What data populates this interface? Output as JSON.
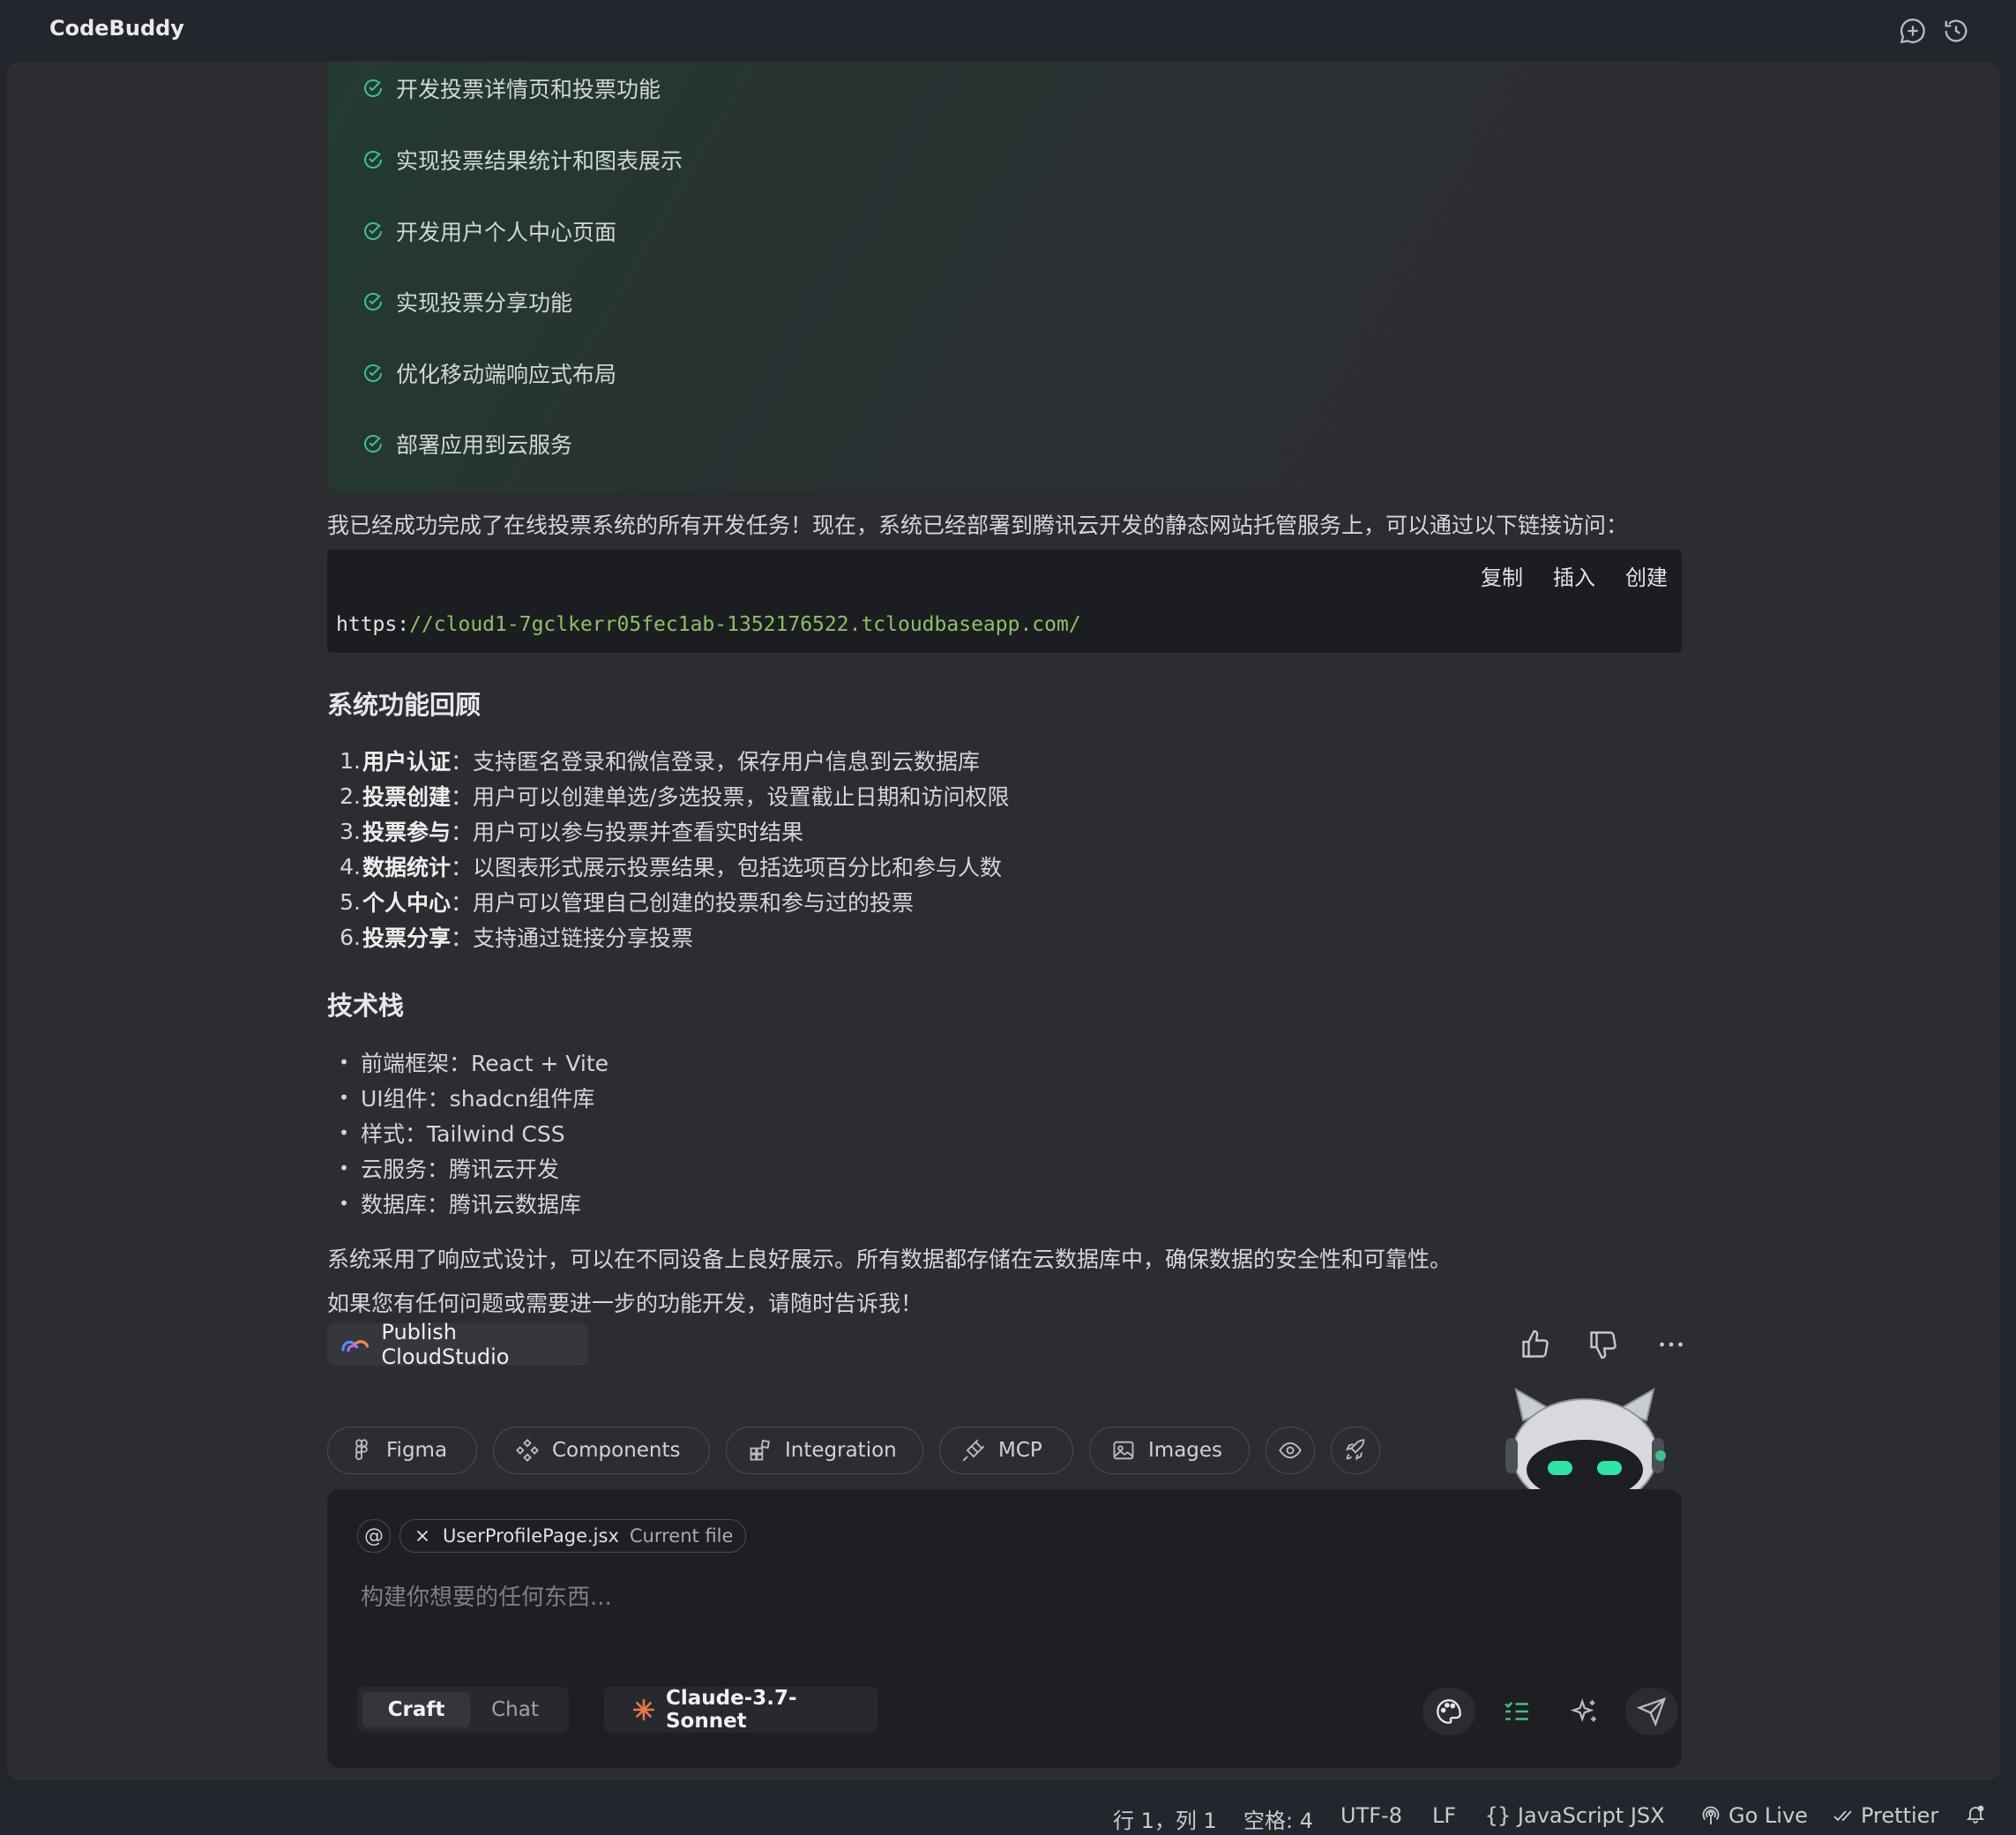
{
  "app": {
    "title": "CodeBuddy"
  },
  "tasks": [
    "开发投票详情页和投票功能",
    "实现投票结果统计和图表展示",
    "开发用户个人中心页面",
    "实现投票分享功能",
    "优化移动端响应式布局",
    "部署应用到云服务"
  ],
  "message": {
    "intro": "我已经成功完成了在线投票系统的所有开发任务！现在，系统已经部署到腾讯云开发的静态网站托管服务上，可以通过以下链接访问：",
    "code": {
      "actions": {
        "copy": "复制",
        "insert": "插入",
        "create": "创建"
      },
      "prefix": "https:",
      "url": "//cloud1-7gclkerr05fec1ab-1352176522.tcloudbaseapp.com/"
    },
    "features_heading": "系统功能回顾",
    "features": [
      {
        "num": "1.",
        "term": "用户认证",
        "desc": "：支持匿名登录和微信登录，保存用户信息到云数据库"
      },
      {
        "num": "2.",
        "term": "投票创建",
        "desc": "：用户可以创建单选/多选投票，设置截止日期和访问权限"
      },
      {
        "num": "3.",
        "term": "投票参与",
        "desc": "：用户可以参与投票并查看实时结果"
      },
      {
        "num": "4.",
        "term": "数据统计",
        "desc": "：以图表形式展示投票结果，包括选项百分比和参与人数"
      },
      {
        "num": "5.",
        "term": "个人中心",
        "desc": "：用户可以管理自己创建的投票和参与过的投票"
      },
      {
        "num": "6.",
        "term": "投票分享",
        "desc": "：支持通过链接分享投票"
      }
    ],
    "stack_heading": "技术栈",
    "stack": [
      "前端框架：React + Vite",
      "UI组件：shadcn组件库",
      "样式：Tailwind CSS",
      "云服务：腾讯云开发",
      "数据库：腾讯云数据库"
    ],
    "closing1": "系统采用了响应式设计，可以在不同设备上良好展示。所有数据都存储在云数据库中，确保数据的安全性和可靠性。",
    "closing2": "如果您有任何问题或需要进一步的功能开发，请随时告诉我！",
    "publish_label": "Publish CloudStudio"
  },
  "toolbar": {
    "figma": "Figma",
    "components": "Components",
    "integration": "Integration",
    "mcp": "MCP",
    "images": "Images"
  },
  "input": {
    "at_symbol": "@",
    "file_name": "UserProfilePage.jsx",
    "file_tag": "Current file",
    "placeholder": "构建你想要的任何东西...",
    "mode_craft": "Craft",
    "mode_chat": "Chat",
    "model": "Claude-3.7-Sonnet"
  },
  "status": {
    "position": "行 1，列 1",
    "spaces": "空格: 4",
    "encoding": "UTF-8",
    "eol": "LF",
    "language": "JavaScript JSX",
    "golive": "Go Live",
    "prettier": "Prettier"
  },
  "colors": {
    "accent_green": "#3ec18b",
    "link_green": "#8dc06a",
    "model_orange": "#e5774a"
  }
}
